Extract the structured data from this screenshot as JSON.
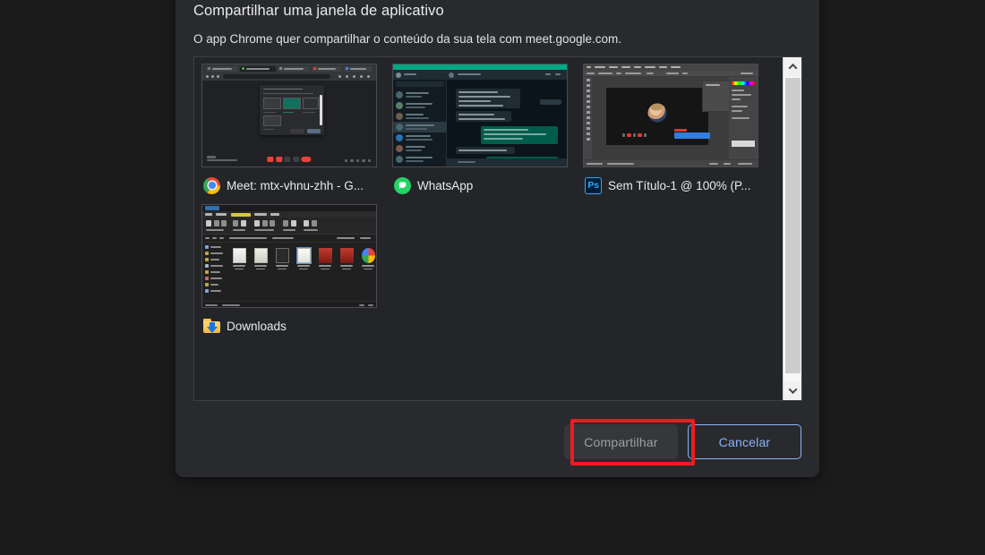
{
  "dialog": {
    "title": "Compartilhar uma janela de aplicativo",
    "subtitle": "O app Chrome quer compartilhar o conteúdo da sua tela com meet.google.com.",
    "share_label": "Compartilhar",
    "cancel_label": "Cancelar",
    "share_enabled": false,
    "accent_color": "#8ab4f8",
    "annotation_color": "#ee1b22",
    "background_color": "#292a2d",
    "page_background": "#1b1b1b"
  },
  "windows": [
    {
      "label": "Meet: mtx-vhnu-zhh - G...",
      "icon": "chrome-icon",
      "app": "chrome"
    },
    {
      "label": "WhatsApp",
      "icon": "whatsapp-icon",
      "app": "whatsapp"
    },
    {
      "label": "Sem Título-1 @ 100% (P...",
      "icon": "photoshop-icon",
      "app": "photoshop"
    },
    {
      "label": "Downloads",
      "icon": "downloads-folder-icon",
      "app": "explorer"
    }
  ],
  "scrollbar": {
    "up_arrow": "chevron-up-icon",
    "down_arrow": "chevron-down-icon",
    "thumb_color": "#cdcdcd",
    "track_color": "#f7f7f7"
  }
}
